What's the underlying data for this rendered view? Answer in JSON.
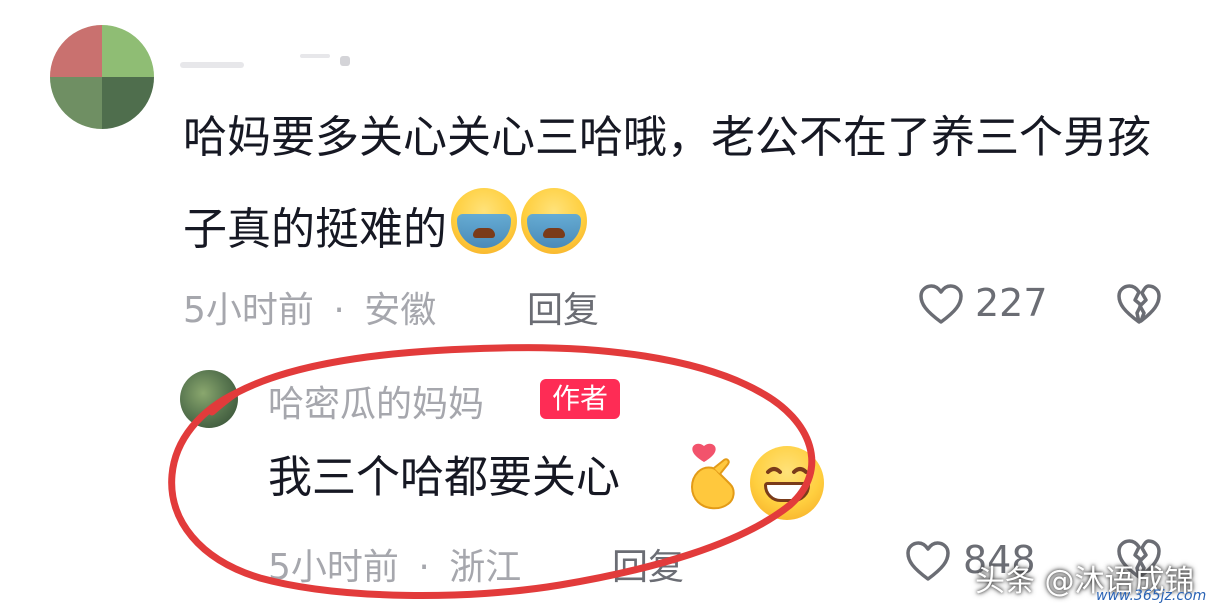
{
  "comment1": {
    "text": "哈妈要多关心关心三哈哦，老公不在了养三个男孩子真的挺难的",
    "emojis": [
      "crying-face-icon",
      "crying-face-icon"
    ],
    "time": "5小时前",
    "location": "安徽",
    "reply_label": "回复",
    "like_count": "227"
  },
  "comment2": {
    "author": "哈密瓜的妈妈",
    "badge": "作者",
    "text": "我三个哈都要关心",
    "emojis": [
      "finger-heart-icon",
      "grinning-face-icon"
    ],
    "time": "5小时前",
    "location": "浙江",
    "reply_label": "回复",
    "like_count": "848"
  },
  "separator": "·",
  "watermark": {
    "text": "头条 @沐语成锦",
    "site": "www.365jz.com"
  },
  "colors": {
    "badge": "#fe2c55",
    "annotation": "#e23b3b",
    "meta": "#a6a7ad"
  }
}
